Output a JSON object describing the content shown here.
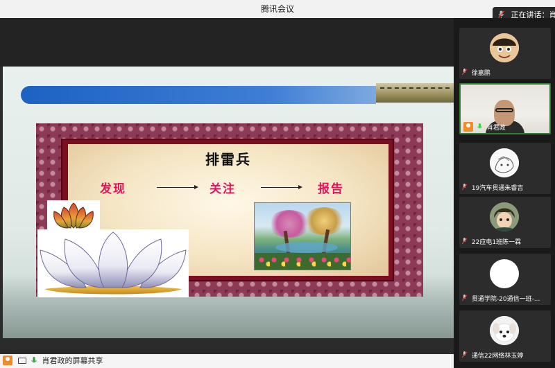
{
  "window": {
    "title": "腾讯会议"
  },
  "speaking": {
    "label": "正在讲话：肖"
  },
  "slide": {
    "title": "排雷兵",
    "steps": [
      "发现",
      "关注",
      "报告"
    ]
  },
  "participants": [
    {
      "name": "徐嘉鹏",
      "mic": "muted",
      "avatar": "cartoon-avatar"
    },
    {
      "name": "肖君政",
      "mic": "on",
      "avatar": "video-feed",
      "active": true
    },
    {
      "name": "19汽车贯通朱睿吉",
      "mic": "muted",
      "avatar": "sketch-avatar"
    },
    {
      "name": "22应电1班陈一霖",
      "mic": "muted",
      "avatar": "anime-avatar"
    },
    {
      "name": "贯通学院-20通信一班-...",
      "mic": "muted",
      "avatar": "blank-avatar"
    },
    {
      "name": "通信22网络林玉婷",
      "mic": "muted",
      "avatar": "puppy-avatar"
    }
  ],
  "status": {
    "share_label": "肖君政的屏幕共享"
  },
  "colors": {
    "accent_green": "#2e7d32",
    "user_orange": "#f28c28",
    "step_pink": "#e0145a"
  }
}
